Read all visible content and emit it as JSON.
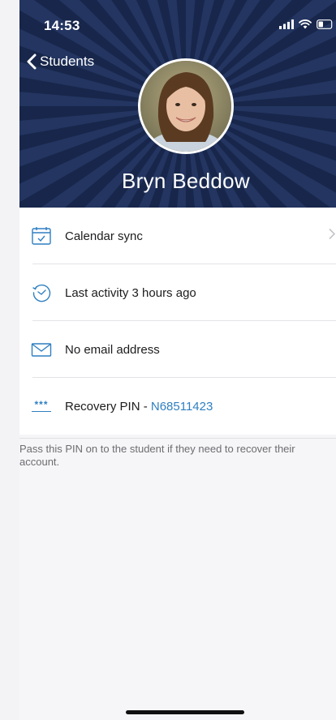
{
  "status_bar": {
    "time": "14:53",
    "icons": [
      "signal-icon",
      "wifi-icon",
      "battery-icon"
    ]
  },
  "nav": {
    "back_label": "Students"
  },
  "profile": {
    "name": "Bryn Beddow"
  },
  "rows": [
    {
      "icon": "calendar-icon",
      "label": "Calendar sync",
      "has_chevron": true
    },
    {
      "icon": "clock-icon",
      "label": "Last activity 3 hours ago"
    },
    {
      "icon": "mail-icon",
      "label": "No email address"
    },
    {
      "icon": "pin-icon",
      "icon_text": "***",
      "label_prefix": "Recovery PIN - ",
      "pin": "N68511423"
    }
  ],
  "footnote": "Pass this PIN on to the student if they need to recover their account.",
  "colors": {
    "header_bg": "#17264a",
    "accent": "#2f7fc1",
    "text": "#1c1c1e",
    "muted": "#6d6d72"
  }
}
